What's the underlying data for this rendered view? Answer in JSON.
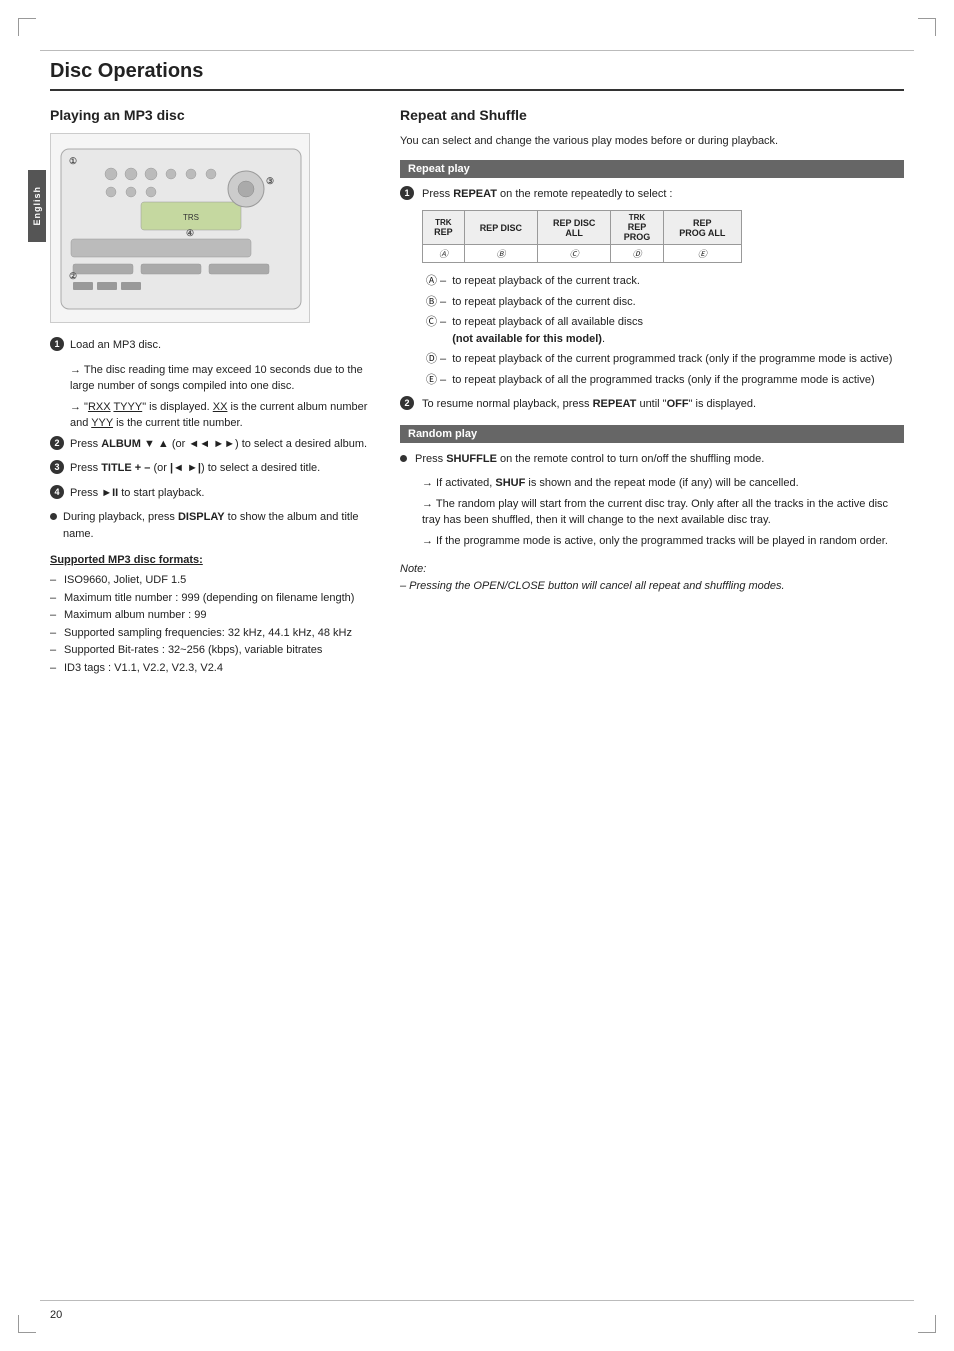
{
  "page": {
    "title": "Disc Operations",
    "page_number": "20",
    "language_tab": "English"
  },
  "left": {
    "section_title": "Playing an MP3 disc",
    "steps": [
      {
        "num": "1",
        "type": "circle",
        "text": "Load an MP3 disc."
      },
      {
        "num": "2",
        "type": "circle",
        "text": "Press ALBUM ▼ ▲ (or ◄◄ ►►) to select a desired album."
      },
      {
        "num": "3",
        "type": "circle",
        "text": "Press TITLE + – (or |◄ ►|) to select a desired title."
      },
      {
        "num": "4",
        "type": "circle",
        "text": "Press ►II to start playback."
      },
      {
        "num": "●",
        "type": "bullet",
        "text": "During playback, press DISPLAY to show the album and title name."
      }
    ],
    "arrow_notes": [
      "→ The disc reading time may exceed 10 seconds due to the large number of songs compiled into one disc.",
      "→ \"RXX  TYYY\" is displayed. XX is the current album number and YYY is the current title number."
    ],
    "formats_heading": "Supported MP3 disc formats:",
    "formats": [
      "ISO9660, Joliet, UDF 1.5",
      "Maximum title number : 999 (depending on filename length)",
      "Maximum album number : 99",
      "Supported sampling frequencies: 32 kHz, 44.1 kHz, 48 kHz",
      "Supported Bit-rates : 32~256 (kbps), variable bitrates",
      "ID3 tags : V1.1, V2.2, V2.3, V2.4"
    ]
  },
  "right": {
    "section_title": "Repeat and Shuffle",
    "intro": "You can select and change the various play modes before or during playback.",
    "repeat_play": {
      "heading": "Repeat play",
      "step1_text": "Press REPEAT on the remote repeatedly to select :",
      "table": {
        "headers": [
          "TRK",
          "REP DISC",
          "REP DISC ALL",
          "TRK REP PROG",
          "REP PROG ALL"
        ],
        "circles": [
          "Ⓐ",
          "Ⓑ",
          "Ⓒ",
          "Ⓓ",
          "Ⓔ"
        ],
        "col_labels": [
          "REP",
          "",
          "",
          "",
          ""
        ],
        "row1": [
          "REP",
          "REP DISC",
          "REP DISC ALL",
          "REP PROG",
          "REP PROG ALL"
        ],
        "row2": [
          "Ⓐ",
          "Ⓑ",
          "Ⓒ",
          "Ⓓ",
          "Ⓔ"
        ]
      },
      "descriptions": [
        {
          "label": "Ⓐ",
          "dash": "–",
          "text": "to repeat playback of the current track."
        },
        {
          "label": "Ⓑ",
          "dash": "–",
          "text": "to repeat playback of the current disc."
        },
        {
          "label": "Ⓒ",
          "dash": "–",
          "text": "to repeat playback of all available discs (not available for this model)."
        },
        {
          "label": "Ⓓ",
          "dash": "–",
          "text": "to repeat playback of the current programmed track (only if the programme mode is active)"
        },
        {
          "label": "Ⓔ",
          "dash": "–",
          "text": "to repeat playback of all the programmed tracks (only if the programme mode is active)"
        }
      ],
      "step2_text": "To resume normal playback, press REPEAT until \"OFF\" is displayed."
    },
    "random_play": {
      "heading": "Random play",
      "step1_text": "Press SHUFFLE on the remote control to turn on/off the shuffling mode.",
      "arrow_notes": [
        "→ If activated, SHUF is shown and the repeat mode (if any) will be cancelled.",
        "→ The random play will start from the current disc tray.  Only after all the tracks in the active disc tray has been shuffled, then it will change to the next available disc tray.",
        "→ If the programme mode is active, only the programmed tracks will be played in random order."
      ]
    },
    "note": {
      "label": "Note:",
      "items": [
        "– Pressing the OPEN/CLOSE button will cancel all repeat and shuffling modes."
      ]
    }
  }
}
